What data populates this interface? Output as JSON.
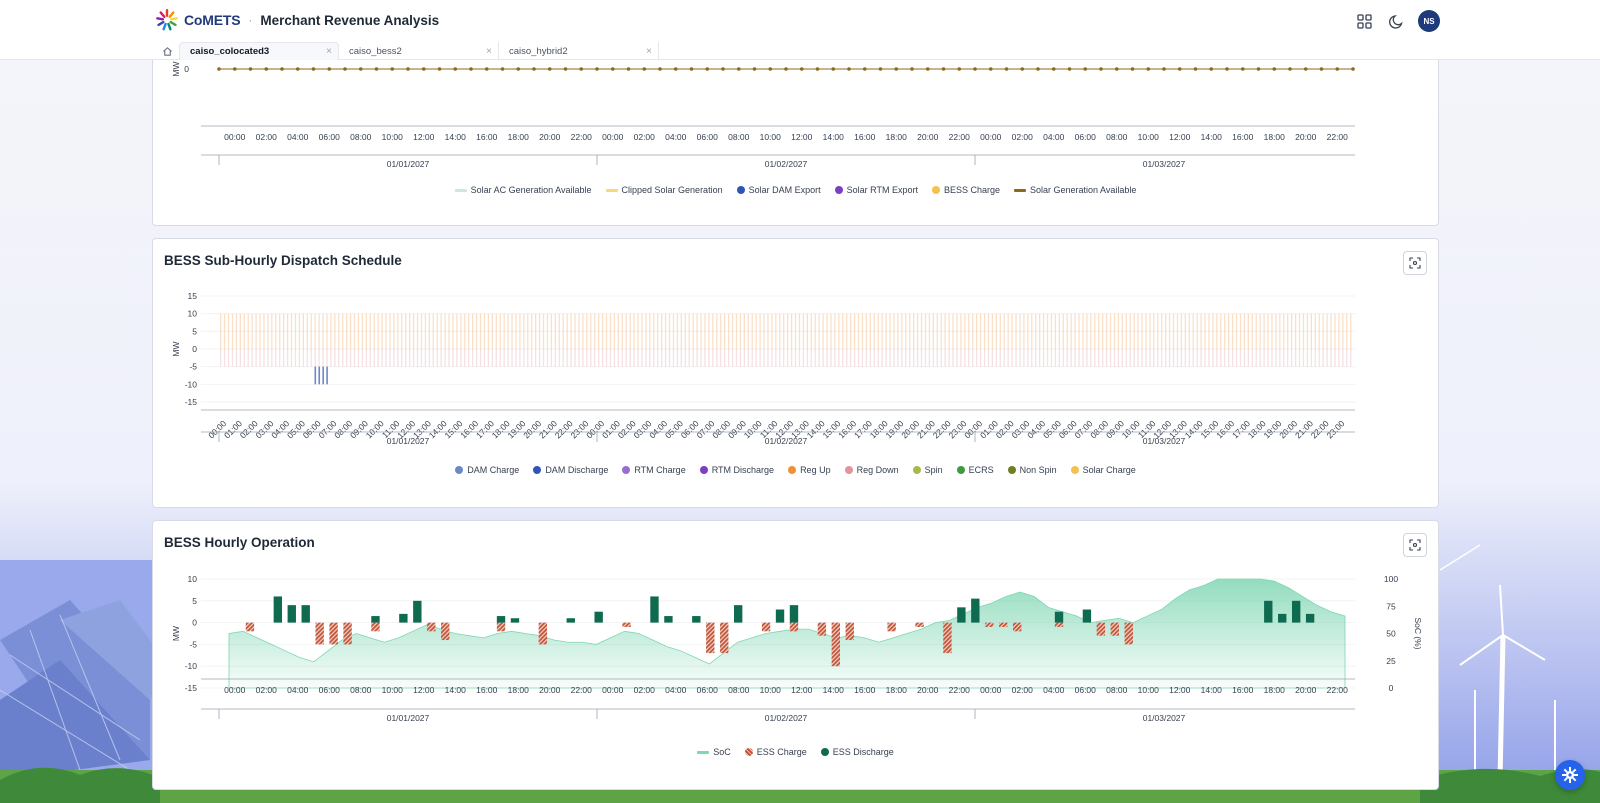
{
  "header": {
    "brand": "CoMETS",
    "separator": "·",
    "title": "Merchant Revenue Analysis",
    "avatar_initials": "NS"
  },
  "tabs": [
    {
      "label": "caiso_colocated3",
      "active": true
    },
    {
      "label": "caiso_bess2",
      "active": false
    },
    {
      "label": "caiso_hybrid2",
      "active": false
    }
  ],
  "tab_close": "×",
  "colors": {
    "brand": "#233a7a",
    "ess_discharge": "#0f6b4f",
    "ess_charge": "#c0563a",
    "soc": "#7fd6b3"
  },
  "chart_data": [
    {
      "id": "solar",
      "type": "line",
      "title": "",
      "ylabel": "MW",
      "y_ticks": [
        "0"
      ],
      "x_tick_labels": [
        "00:00",
        "02:00",
        "04:00",
        "06:00",
        "08:00",
        "10:00",
        "12:00",
        "14:00",
        "16:00",
        "18:00",
        "20:00",
        "22:00",
        "00:00",
        "02:00",
        "04:00",
        "06:00",
        "08:00",
        "10:00",
        "12:00",
        "14:00",
        "16:00",
        "18:00",
        "20:00",
        "22:00",
        "00:00",
        "02:00",
        "04:00",
        "06:00",
        "08:00",
        "10:00",
        "12:00",
        "14:00",
        "16:00",
        "18:00",
        "20:00",
        "22:00"
      ],
      "date_labels": [
        "01/01/2027",
        "01/02/2027",
        "01/03/2027"
      ],
      "series": [
        {
          "name": "Solar AC Generation Available",
          "color": "#cfe8da",
          "values": []
        },
        {
          "name": "Clipped Solar Generation",
          "color": "#f6d97a",
          "values": []
        },
        {
          "name": "Solar DAM Export",
          "color": "#2f55b7",
          "values": []
        },
        {
          "name": "Solar RTM Export",
          "color": "#7a3fc4",
          "values": []
        },
        {
          "name": "BESS Charge",
          "color": "#f2c14e",
          "values": []
        },
        {
          "name": "Solar Generation Available",
          "color": "#8b6a1c",
          "constant_value": 0
        }
      ]
    },
    {
      "id": "subhourly",
      "type": "bar",
      "title": "BESS Sub-Hourly Dispatch Schedule",
      "ylabel": "MW",
      "ylim": [
        -15,
        15
      ],
      "y_ticks": [
        "15",
        "10",
        "5",
        "0",
        "-5",
        "-10",
        "-15"
      ],
      "x_tick_labels": [
        "00:00",
        "01:00",
        "02:00",
        "03:00",
        "04:00",
        "05:00",
        "06:00",
        "07:00",
        "08:00",
        "09:00",
        "10:00",
        "11:00",
        "12:00",
        "13:00",
        "14:00",
        "15:00",
        "16:00",
        "17:00",
        "18:00",
        "19:00",
        "20:00",
        "21:00",
        "22:00",
        "23:00",
        "00:00",
        "01:00",
        "02:00",
        "03:00",
        "04:00",
        "05:00",
        "06:00",
        "07:00",
        "08:00",
        "09:00",
        "10:00",
        "11:00",
        "12:00",
        "13:00",
        "14:00",
        "15:00",
        "16:00",
        "17:00",
        "18:00",
        "19:00",
        "20:00",
        "21:00",
        "22:00",
        "23:00",
        "00:00",
        "01:00",
        "02:00",
        "03:00",
        "04:00",
        "05:00",
        "06:00",
        "07:00",
        "08:00",
        "09:00",
        "10:00",
        "11:00",
        "12:00",
        "13:00",
        "14:00",
        "15:00",
        "16:00",
        "17:00",
        "18:00",
        "19:00",
        "20:00",
        "21:00",
        "22:00",
        "23:00"
      ],
      "date_labels": [
        "01/01/2027",
        "01/02/2027",
        "01/03/2027"
      ],
      "series": [
        {
          "name": "DAM Charge",
          "color": "#6d88c9"
        },
        {
          "name": "DAM Discharge",
          "color": "#2f55b7"
        },
        {
          "name": "RTM Charge",
          "color": "#9b6bd1"
        },
        {
          "name": "RTM Discharge",
          "color": "#7a3fc4"
        },
        {
          "name": "Reg Up",
          "color": "#f0913a"
        },
        {
          "name": "Reg Down",
          "color": "#e0959b"
        },
        {
          "name": "Spin",
          "color": "#a8b84a"
        },
        {
          "name": "ECRS",
          "color": "#3e9b3e"
        },
        {
          "name": "Non Spin",
          "color": "#6f7f22"
        },
        {
          "name": "Solar Charge",
          "color": "#f2c14e"
        }
      ],
      "reg_up_values": [
        10,
        10,
        10,
        10,
        10,
        10,
        10,
        10,
        10,
        10,
        10,
        10,
        10,
        10,
        10,
        10,
        10,
        10,
        10,
        10,
        10,
        10,
        10,
        10,
        10,
        10,
        10,
        10,
        10,
        10,
        10,
        10,
        10,
        10,
        10,
        10,
        10,
        10,
        10,
        10,
        10,
        10,
        10,
        10,
        10,
        10,
        10,
        10,
        10,
        10,
        10,
        10,
        10,
        10,
        10,
        10,
        10,
        10,
        10,
        10,
        10,
        10,
        10,
        10,
        10,
        10,
        10,
        10,
        10,
        10,
        10,
        10
      ],
      "reg_down_values": [
        -5,
        -5,
        -5,
        -5,
        -5,
        -5,
        -5,
        -5,
        -5,
        -5,
        -5,
        -5,
        -5,
        -5,
        -5,
        -5,
        -5,
        -5,
        -5,
        -5,
        -5,
        -5,
        -5,
        -5,
        -5,
        -5,
        -5,
        -5,
        -5,
        -5,
        -5,
        -5,
        -5,
        -5,
        -5,
        -5,
        -5,
        -5,
        -5,
        -5,
        -5,
        -5,
        -5,
        -5,
        -5,
        -5,
        -5,
        -5,
        -5,
        -5,
        -5,
        -5,
        -5,
        -5,
        -5,
        -5,
        -5,
        -5,
        -5,
        -5,
        -5,
        -5,
        -5,
        -5,
        -5,
        -5,
        -5,
        -5,
        -5,
        -5,
        -5,
        -5
      ],
      "dam_charge_values": [
        0,
        0,
        0,
        0,
        0,
        0,
        -10,
        0,
        0,
        0,
        0,
        0,
        0,
        0,
        0,
        0,
        0,
        0,
        0,
        0,
        0,
        0,
        0,
        0,
        0,
        0,
        0,
        0,
        0,
        0,
        0,
        0,
        0,
        0,
        0,
        0,
        0,
        0,
        0,
        0,
        0,
        0,
        0,
        0,
        0,
        0,
        0,
        0,
        0,
        0,
        0,
        0,
        0,
        0,
        0,
        0,
        0,
        0,
        0,
        0,
        0,
        0,
        0,
        0,
        0,
        0,
        0,
        0,
        0,
        0,
        0,
        0
      ]
    },
    {
      "id": "hourly",
      "type": "bar",
      "title": "BESS Hourly Operation",
      "ylabel": "MW",
      "y2label": "SoC (%)",
      "ylim": [
        -15,
        10
      ],
      "y2lim": [
        0,
        100
      ],
      "y_ticks": [
        "10",
        "5",
        "0",
        "-5",
        "-10",
        "-15"
      ],
      "y2_ticks": [
        "100",
        "75",
        "50",
        "25",
        "0"
      ],
      "x_tick_labels": [
        "00:00",
        "02:00",
        "04:00",
        "06:00",
        "08:00",
        "10:00",
        "12:00",
        "14:00",
        "16:00",
        "18:00",
        "20:00",
        "22:00",
        "00:00",
        "02:00",
        "04:00",
        "06:00",
        "08:00",
        "10:00",
        "12:00",
        "14:00",
        "16:00",
        "18:00",
        "20:00",
        "22:00",
        "00:00",
        "02:00",
        "04:00",
        "06:00",
        "08:00",
        "10:00",
        "12:00",
        "14:00",
        "16:00",
        "18:00",
        "20:00",
        "22:00"
      ],
      "date_labels": [
        "01/01/2027",
        "01/02/2027",
        "01/03/2027"
      ],
      "series": [
        {
          "name": "SoC",
          "color": "#7fd6b3",
          "values": [
            50,
            52,
            46,
            40,
            34,
            28,
            24,
            34,
            44,
            50,
            46,
            42,
            46,
            52,
            58,
            54,
            50,
            48,
            46,
            50,
            52,
            50,
            48,
            44,
            42,
            42,
            40,
            46,
            52,
            50,
            44,
            38,
            34,
            28,
            22,
            32,
            42,
            46,
            50,
            52,
            54,
            54,
            50,
            46,
            48,
            46,
            42,
            46,
            50,
            54,
            60,
            62,
            68,
            74,
            78,
            84,
            88,
            84,
            74,
            70,
            66,
            60,
            62,
            64,
            60,
            66,
            72,
            82,
            90,
            94,
            100,
            100,
            100,
            100,
            98,
            92,
            84,
            76,
            70,
            66
          ]
        },
        {
          "name": "ESS Charge",
          "color": "#c0563a",
          "values": [
            0,
            -2,
            0,
            0,
            0,
            0,
            -5,
            -5,
            -5,
            0,
            -2,
            0,
            0,
            0,
            -2,
            -4,
            0,
            0,
            0,
            -2,
            0,
            0,
            -5,
            0,
            0,
            0,
            0,
            0,
            -1,
            0,
            0,
            0,
            0,
            0,
            -7,
            -7,
            0,
            0,
            -2,
            0,
            -2,
            0,
            -3,
            -10,
            -4,
            0,
            0,
            -2,
            0,
            -1,
            0,
            -7,
            0,
            0,
            -1,
            -1,
            -2,
            0,
            0,
            -1,
            0,
            0,
            -3,
            -3,
            -5,
            0,
            0,
            0,
            0,
            0,
            0,
            0,
            0,
            0,
            0,
            0,
            0,
            0,
            0,
            0
          ]
        },
        {
          "name": "ESS Discharge",
          "color": "#0f6b4f",
          "values": [
            0,
            0,
            0,
            6,
            4,
            4,
            0,
            0,
            0,
            0,
            1.5,
            0,
            2,
            5,
            0,
            0,
            0,
            0,
            0,
            1.5,
            1,
            0,
            0,
            0,
            1,
            0,
            2.5,
            0,
            0,
            0,
            6,
            1.5,
            0,
            1.5,
            0,
            0,
            4,
            0,
            0,
            3,
            4,
            0,
            0,
            0,
            0,
            0,
            0,
            0,
            0,
            0,
            0,
            0,
            3.5,
            5.5,
            0,
            0,
            0,
            0,
            0,
            2.5,
            0,
            3,
            0,
            0,
            0,
            0,
            0,
            0,
            0,
            0,
            0,
            0,
            0,
            0,
            5,
            2,
            5,
            2,
            0,
            0
          ]
        }
      ]
    }
  ]
}
